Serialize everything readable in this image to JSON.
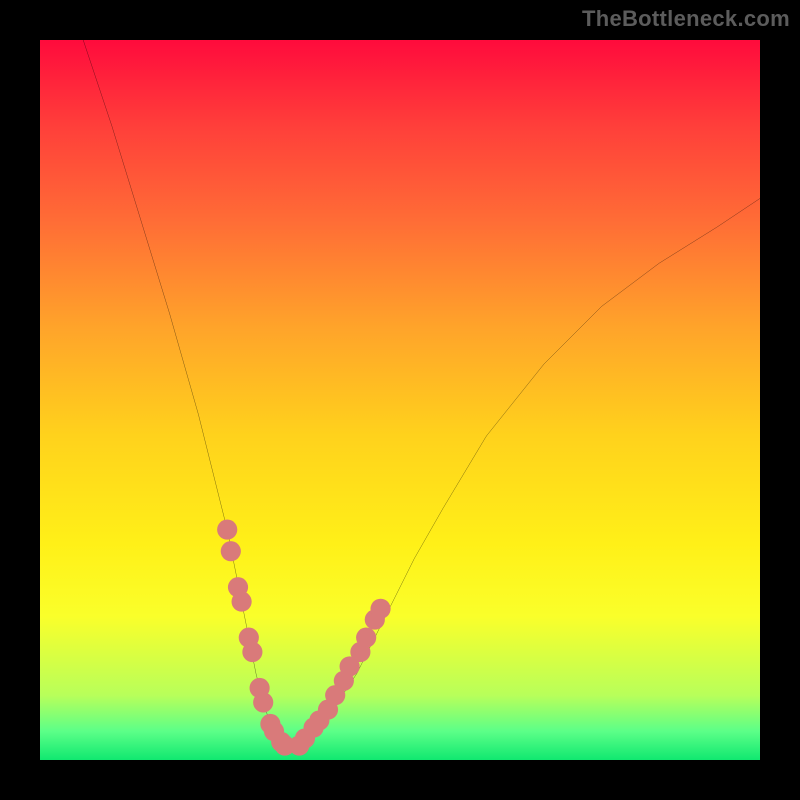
{
  "watermark": "TheBottleneck.com",
  "colors": {
    "frame": "#000000",
    "curve_stroke": "#000000",
    "marker_fill": "#d97a7a",
    "marker_stroke": "#d97a7a"
  },
  "chart_data": {
    "type": "line",
    "title": "",
    "xlabel": "",
    "ylabel": "",
    "xlim": [
      0,
      100
    ],
    "ylim": [
      0,
      100
    ],
    "grid": false,
    "legend": false,
    "background": "rainbow-gradient-vertical",
    "series": [
      {
        "name": "bottleneck-curve",
        "x": [
          6,
          10,
          14,
          18,
          22,
          24,
          26,
          28,
          29,
          30,
          31,
          32,
          33,
          34,
          35,
          36,
          37,
          40,
          44,
          48,
          52,
          56,
          62,
          70,
          78,
          86,
          94,
          100
        ],
        "y": [
          100,
          88,
          75,
          62,
          48,
          40,
          32,
          22,
          17,
          12,
          8,
          5,
          3,
          2,
          2,
          2,
          3,
          6,
          12,
          20,
          28,
          35,
          45,
          55,
          63,
          69,
          74,
          78
        ]
      }
    ],
    "markers": [
      {
        "name": "highlight-dots-left",
        "x": [
          26.0,
          26.5,
          27.5,
          28.0,
          29.0,
          29.5,
          30.5,
          31.0,
          32.0,
          32.5,
          33.5,
          34.0
        ],
        "y": [
          32,
          29,
          24,
          22,
          17,
          15,
          10,
          8,
          5,
          4,
          2.5,
          2
        ]
      },
      {
        "name": "highlight-dots-right",
        "x": [
          36.0,
          36.8,
          38.0,
          38.8,
          40.0,
          41.0,
          42.2,
          43.0,
          44.5,
          45.3,
          46.5,
          47.3
        ],
        "y": [
          2,
          3,
          4.5,
          5.5,
          7,
          9,
          11,
          13,
          15,
          17,
          19.5,
          21
        ]
      }
    ],
    "gradient_stops": [
      {
        "pct": 0,
        "color": "#ff0b3c"
      },
      {
        "pct": 12,
        "color": "#ff3f3a"
      },
      {
        "pct": 25,
        "color": "#ff6c36"
      },
      {
        "pct": 40,
        "color": "#ffa42a"
      },
      {
        "pct": 55,
        "color": "#ffd21c"
      },
      {
        "pct": 70,
        "color": "#fff018"
      },
      {
        "pct": 80,
        "color": "#faff2a"
      },
      {
        "pct": 91,
        "color": "#b8ff5a"
      },
      {
        "pct": 96,
        "color": "#5cff88"
      },
      {
        "pct": 100,
        "color": "#10e870"
      }
    ]
  }
}
